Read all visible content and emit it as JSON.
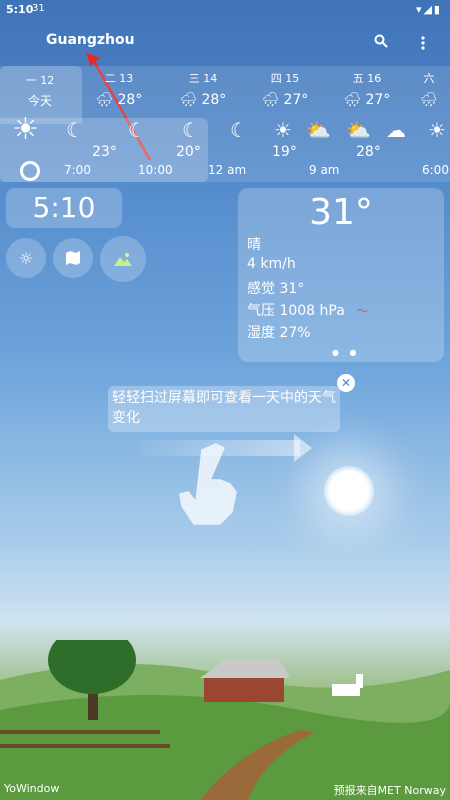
{
  "status": {
    "time": "5:10",
    "extra": "31",
    "icons": "▾◢▮"
  },
  "header": {
    "city": "Guangzhou",
    "search_icon": "search-icon",
    "menu_icon": "more-vert-icon"
  },
  "days": [
    {
      "label": "一 12",
      "sub": "今天",
      "temp": "",
      "icon": "sun-icon"
    },
    {
      "label": "二 13",
      "temp": "28°",
      "icon": "rain-cloud-icon"
    },
    {
      "label": "三 14",
      "temp": "28°",
      "icon": "rain-cloud-icon"
    },
    {
      "label": "四 15",
      "temp": "27°",
      "icon": "rain-cloud-icon"
    },
    {
      "label": "五 16",
      "temp": "27°",
      "icon": "rain-cloud-icon"
    },
    {
      "label": "六",
      "temp": "",
      "icon": "rain-cloud-icon"
    }
  ],
  "hours": {
    "temps": [
      "23°",
      "20°",
      "19°",
      "28°"
    ],
    "labels": [
      "7:00",
      "10:00",
      "12 am",
      "9 am",
      "6:00"
    ]
  },
  "clock": {
    "time": "5:10"
  },
  "current": {
    "temp": "31°",
    "condition": "晴",
    "wind": "4 km/h",
    "feels": "感觉 31°",
    "pressure": "气压 1008 hPa",
    "humidity": "湿度 27%"
  },
  "hint": {
    "text": "轻轻扫过屏幕即可查看一天中的天气变化"
  },
  "footer": {
    "left": "YoWindow",
    "right": "预报来自MET Norway"
  }
}
